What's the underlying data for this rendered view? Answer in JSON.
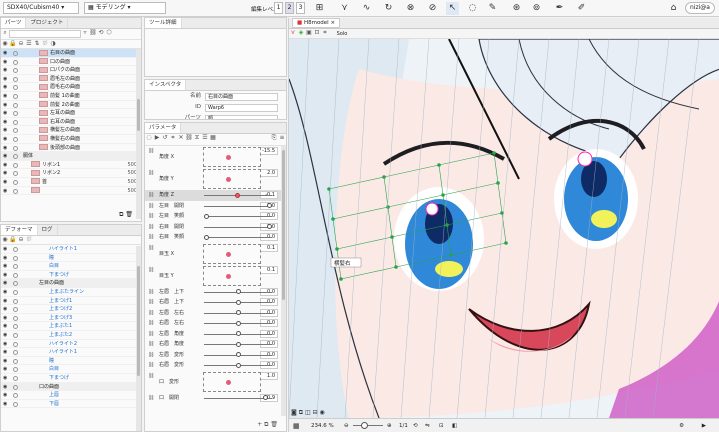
{
  "toolbar": {
    "file_select": "SDX40/Cubism40",
    "mode_select": "モデリング",
    "edit_level_label": "編集レベル：",
    "levels": [
      "1",
      "2",
      "3"
    ],
    "tool_labels": [
      "",
      "",
      "",
      "",
      "",
      "",
      "",
      ""
    ],
    "user": "nizi@a"
  },
  "parts_panel": {
    "tabs": [
      "パーツ",
      "プロジェクト"
    ],
    "rows": [
      {
        "name": "右目の曲面",
        "val": ""
      },
      {
        "name": "口の曲面",
        "val": ""
      },
      {
        "name": "口パクの曲面",
        "val": ""
      },
      {
        "name": "眉毛左の曲面",
        "val": ""
      },
      {
        "name": "眉毛右の曲面",
        "val": ""
      },
      {
        "name": "前髪 1の曲面",
        "val": ""
      },
      {
        "name": "前髪 2の曲面",
        "val": ""
      },
      {
        "name": "左耳の曲面",
        "val": ""
      },
      {
        "name": "右耳の曲面",
        "val": ""
      },
      {
        "name": "横髪左の曲面",
        "val": ""
      },
      {
        "name": "横髪右の曲面",
        "val": ""
      },
      {
        "name": "後頭部の曲面",
        "val": ""
      },
      {
        "name": "胴体",
        "val": ""
      },
      {
        "name": "リボン1",
        "val": "500"
      },
      {
        "name": "リボン2",
        "val": "500"
      },
      {
        "name": "首",
        "val": "500"
      },
      {
        "name": "",
        "val": "500"
      }
    ]
  },
  "deformer_panel": {
    "tabs": [
      "デフォーマ",
      "ログ"
    ],
    "rows": [
      {
        "name": "ハイライト1",
        "t": "b"
      },
      {
        "name": "瞳",
        "t": "b"
      },
      {
        "name": "白目",
        "t": "b"
      },
      {
        "name": "下まつげ",
        "t": "b"
      },
      {
        "name": "左目の曲面",
        "t": "g"
      },
      {
        "name": "上まぶたライン",
        "t": "b"
      },
      {
        "name": "上まつげ1",
        "t": "b"
      },
      {
        "name": "上まつげ2",
        "t": "b"
      },
      {
        "name": "上まつげ3",
        "t": "b"
      },
      {
        "name": "上まぶた1",
        "t": "b"
      },
      {
        "name": "上まぶた2",
        "t": "b"
      },
      {
        "name": "ハイライト2",
        "t": "b"
      },
      {
        "name": "ハイライト1",
        "t": "b"
      },
      {
        "name": "瞳",
        "t": "b"
      },
      {
        "name": "白目",
        "t": "b"
      },
      {
        "name": "下まつげ",
        "t": "b"
      },
      {
        "name": "口の曲面",
        "t": "g"
      },
      {
        "name": "上唇",
        "t": "b"
      },
      {
        "name": "下唇",
        "t": "b"
      }
    ]
  },
  "tool_detail": {
    "title": "ツール詳細"
  },
  "inspector": {
    "title": "インスペクタ",
    "fields": [
      {
        "label": "名前",
        "value": "右目の曲面"
      },
      {
        "label": "ID",
        "value": "Warp6"
      },
      {
        "label": "パーツ",
        "value": "顔"
      }
    ]
  },
  "parameters": {
    "title": "パラメータ",
    "rows": [
      {
        "name": "角度 X",
        "value": "-15.5",
        "grid": true
      },
      {
        "name": "角度 Y",
        "value": "2.0",
        "grid": true
      },
      {
        "name": "角度 Z",
        "value": "-0.1",
        "hl": true,
        "k": 0.48
      },
      {
        "name": "左目　開閉",
        "value": "1.0",
        "k": 0.95
      },
      {
        "name": "左目　笑顔",
        "value": "0.0",
        "k": 0.03
      },
      {
        "name": "右目　開閉",
        "value": "1.0",
        "k": 0.95
      },
      {
        "name": "右目　笑顔",
        "value": "0.0",
        "k": 0.03
      },
      {
        "name": "目玉 X",
        "value": "0.1",
        "grid": true
      },
      {
        "name": "目玉 Y",
        "value": "0.1",
        "grid": true
      },
      {
        "name": "左眉　上下",
        "value": "0.0",
        "k": 0.5
      },
      {
        "name": "右眉　上下",
        "value": "0.0",
        "k": 0.5
      },
      {
        "name": "左眉　左右",
        "value": "0.0",
        "k": 0.5
      },
      {
        "name": "右眉　左右",
        "value": "0.0",
        "k": 0.5
      },
      {
        "name": "左眉　角度",
        "value": "0.0",
        "k": 0.5
      },
      {
        "name": "右眉　角度",
        "value": "0.0",
        "k": 0.5
      },
      {
        "name": "左眉　変形",
        "value": "0.0",
        "k": 0.5
      },
      {
        "name": "右眉　変形",
        "value": "0.0",
        "k": 0.5
      },
      {
        "name": "口　変形",
        "value": "1.0",
        "grid": true
      },
      {
        "name": "口　開閉",
        "value": "0.9",
        "k": 0.9
      }
    ]
  },
  "viewport": {
    "tab": "H8model",
    "solo_label": "Solo",
    "zoom": "234.6 %",
    "page": "1/1",
    "warp_label": "横髪右",
    "skin": "#fbe9e6",
    "eye_color": "#2f88d8"
  }
}
